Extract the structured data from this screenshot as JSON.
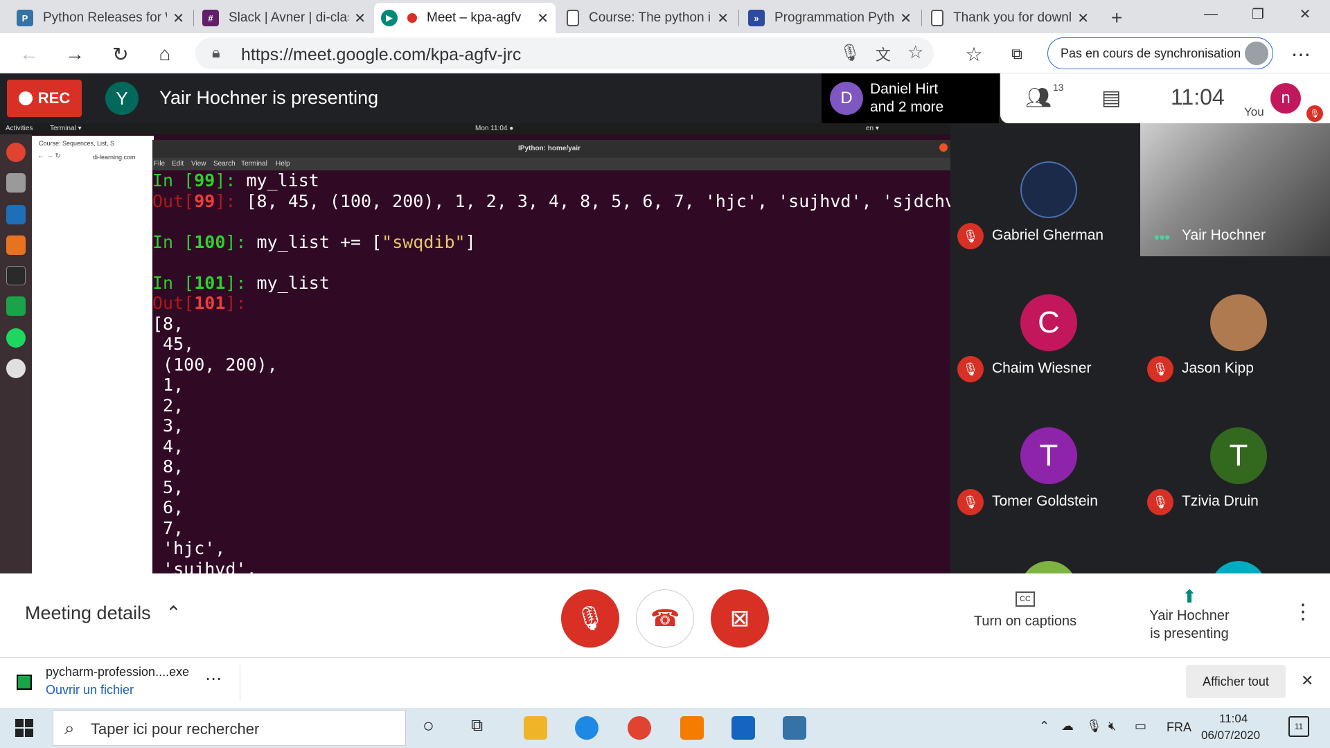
{
  "browser": {
    "tabs": [
      {
        "title": "Python Releases for W",
        "icon": "python-icon"
      },
      {
        "title": "Slack | Avner | di-clas",
        "icon": "slack-icon"
      },
      {
        "title": "Meet – kpa-agfv",
        "icon": "meet-icon",
        "active": true
      },
      {
        "title": "Course: The python i",
        "icon": "page-icon"
      },
      {
        "title": "Programmation Pyth",
        "icon": "site-icon"
      },
      {
        "title": "Thank you for downl",
        "icon": "page-icon"
      }
    ],
    "url": "https://meet.google.com/kpa-agfv-jrc",
    "sync_label": "Pas en cours de synchronisation"
  },
  "meet": {
    "rec_label": "REC",
    "presenter_initial": "Y",
    "presenting_text": "Yair Hochner is presenting",
    "pinned": {
      "initial": "D",
      "line1": "Daniel Hirt",
      "line2": "and 2 more"
    },
    "participant_count": "13",
    "time": "11:04",
    "self_initial": "n",
    "self_label": "You",
    "participants": [
      {
        "name": "Gabriel Gherman",
        "initial": "",
        "color": "#1c2a4a",
        "muted": true
      },
      {
        "name": "Yair Hochner",
        "initial": "",
        "color": "#5a5a5a",
        "muted": false,
        "video": true
      },
      {
        "name": "Chaim Wiesner",
        "initial": "C",
        "color": "#c2185b",
        "muted": true
      },
      {
        "name": "Jason Kipp",
        "initial": "",
        "color": "#b07a50",
        "muted": true
      },
      {
        "name": "Tomer Goldstein",
        "initial": "T",
        "color": "#8e24aa",
        "muted": true
      },
      {
        "name": "Tzivia Druin",
        "initial": "T",
        "color": "#33691e",
        "muted": true
      }
    ],
    "meeting_details": "Meeting details",
    "captions_label": "Turn on captions",
    "presenting_btn_line1": "Yair Hochner",
    "presenting_btn_line2": "is presenting"
  },
  "shared_screen": {
    "activities": "Activities",
    "terminal_menu": "Terminal ▾",
    "ubuntu_clock": "Mon 11:04 ●",
    "lang": "en ▾",
    "chrome_tab": "Course: Sequences, List, S",
    "chrome_url": "di-learning.com",
    "terminal_title": "IPython: home/yair",
    "terminal_menu_items": [
      "File",
      "Edit",
      "View",
      "Search",
      "Terminal",
      "Help"
    ]
  },
  "download": {
    "filename": "pycharm-profession....exe",
    "open_label": "Ouvrir un fichier",
    "show_all": "Afficher tout"
  },
  "taskbar": {
    "search_placeholder": "Taper ici pour rechercher",
    "lang": "FRA",
    "time": "11:04",
    "date": "06/07/2020",
    "notifications": "11"
  },
  "colors": {
    "meet_red": "#d93025",
    "terminal_bg": "#300a24",
    "meet_dark": "#202124"
  }
}
